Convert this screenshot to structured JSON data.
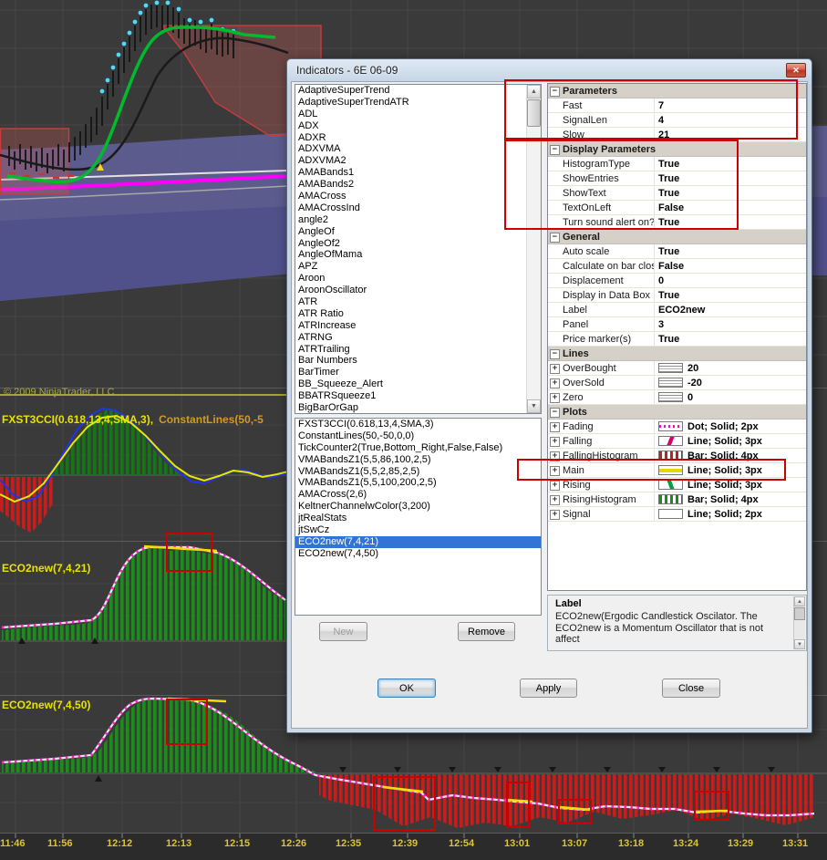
{
  "window": {
    "title": "Indicators - 6E 06-09"
  },
  "icons": {
    "close": "✕",
    "scroll_up": "▲",
    "scroll_down": "▼"
  },
  "available_indicators": [
    "AdaptiveSuperTrend",
    "AdaptiveSuperTrendATR",
    "ADL",
    "ADX",
    "ADXR",
    "ADXVMA",
    "ADXVMA2",
    "AMABands1",
    "AMABands2",
    "AMACross",
    "AMACrossInd",
    "angle2",
    "AngleOf",
    "AngleOf2",
    "AngleOfMama",
    "APZ",
    "Aroon",
    "AroonOscillator",
    "ATR",
    "ATR Ratio",
    "ATRIncrease",
    "ATRNG",
    "ATRTrailing",
    "Bar Numbers",
    "BarTimer",
    "BB_Squeeze_Alert",
    "BBATRSqueeze1",
    "BigBarOrGap"
  ],
  "configured_indicators": [
    {
      "label": "FXST3CCI(0.618,13,4,SMA,3)",
      "selected": false
    },
    {
      "label": "ConstantLines(50,-50,0,0)",
      "selected": false
    },
    {
      "label": "TickCounter2(True,Bottom_Right,False,False)",
      "selected": false
    },
    {
      "label": "VMABandsZ1(5,5,86,100,2,5)",
      "selected": false
    },
    {
      "label": "VMABandsZ1(5,5,2,85,2,5)",
      "selected": false
    },
    {
      "label": "VMABandsZ1(5,5,100,200,2,5)",
      "selected": false
    },
    {
      "label": "AMACross(2,6)",
      "selected": false
    },
    {
      "label": "KeltnerChannelwColor(3,200)",
      "selected": false
    },
    {
      "label": "jtRealStats",
      "selected": false
    },
    {
      "label": "jtSwCz",
      "selected": false
    },
    {
      "label": "ECO2new(7,4,21)",
      "selected": true
    },
    {
      "label": "ECO2new(7,4,50)",
      "selected": false
    }
  ],
  "actions": {
    "new": "New",
    "remove": "Remove",
    "ok": "OK",
    "apply": "Apply",
    "close": "Close"
  },
  "property_grid": {
    "rows": [
      {
        "type": "section",
        "name": "Parameters"
      },
      {
        "type": "prop",
        "name": "Fast",
        "value": "7"
      },
      {
        "type": "prop",
        "name": "SignalLen",
        "value": "4"
      },
      {
        "type": "prop",
        "name": "Slow",
        "value": "21"
      },
      {
        "type": "section",
        "name": "Display Parameters"
      },
      {
        "type": "prop",
        "name": "HistogramType",
        "value": "True"
      },
      {
        "type": "prop",
        "name": "ShowEntries",
        "value": "True"
      },
      {
        "type": "prop",
        "name": "ShowText",
        "value": "True"
      },
      {
        "type": "prop",
        "name": "TextOnLeft",
        "value": "False"
      },
      {
        "type": "prop",
        "name": "Turn sound alert on?",
        "value": "True"
      },
      {
        "type": "section",
        "name": "General"
      },
      {
        "type": "prop",
        "name": "Auto scale",
        "value": "True"
      },
      {
        "type": "prop",
        "name": "Calculate on bar close",
        "value": "False"
      },
      {
        "type": "prop",
        "name": "Displacement",
        "value": "0"
      },
      {
        "type": "prop",
        "name": "Display in Data Box",
        "value": "True"
      },
      {
        "type": "prop",
        "name": "Label",
        "value": "ECO2new"
      },
      {
        "type": "prop",
        "name": "Panel",
        "value": "3"
      },
      {
        "type": "prop",
        "name": "Price marker(s)",
        "value": "True"
      },
      {
        "type": "section",
        "name": "Lines"
      },
      {
        "type": "prop",
        "name": "OverBought",
        "value": "20",
        "expand": true,
        "swatch": "lines"
      },
      {
        "type": "prop",
        "name": "OverSold",
        "value": "-20",
        "expand": true,
        "swatch": "lines"
      },
      {
        "type": "prop",
        "name": "Zero",
        "value": "0",
        "expand": true,
        "swatch": "lines"
      },
      {
        "type": "section",
        "name": "Plots"
      },
      {
        "type": "prop",
        "name": "Fading",
        "value": "Dot; Solid; 2px",
        "expand": true,
        "swatch": "fading"
      },
      {
        "type": "prop",
        "name": "Falling",
        "value": "Line; Solid; 3px",
        "expand": true,
        "swatch": "falling"
      },
      {
        "type": "prop",
        "name": "FallingHistogram",
        "value": "Bar; Solid; 4px",
        "expand": true,
        "swatch": "falling-histogram"
      },
      {
        "type": "prop",
        "name": "Main",
        "value": "Line; Solid; 3px",
        "expand": true,
        "swatch": "main"
      },
      {
        "type": "prop",
        "name": "Rising",
        "value": "Line; Solid; 3px",
        "expand": true,
        "swatch": "rising"
      },
      {
        "type": "prop",
        "name": "RisingHistogram",
        "value": "Bar; Solid; 4px",
        "expand": true,
        "swatch": "rising-histogram"
      },
      {
        "type": "prop",
        "name": "Signal",
        "value": "Line; Solid; 2px",
        "expand": true,
        "swatch": "signal"
      }
    ]
  },
  "help_panel": {
    "title": "Label",
    "text": "ECO2new(Ergodic Candlestick Oscilator.  The ECO2new is a Momentum Oscillator that is not affect"
  },
  "chart": {
    "copyright": "© 2009 NinjaTrader, LLC",
    "labels": {
      "panel2_a": "FXST3CCI(0.618,13,4,SMA,3),",
      "panel2_b": "ConstantLines(50,-5",
      "panel3": "ECO2new(7,4,21)",
      "panel4": "ECO2new(7,4,50)"
    },
    "time_axis": [
      "11:46",
      "11:56",
      "12:12",
      "12:13",
      "12:15",
      "12:26",
      "12:35",
      "12:39",
      "12:54",
      "13:01",
      "13:07",
      "13:18",
      "13:24",
      "13:29",
      "13:31"
    ]
  },
  "colors": {
    "selection": "#3273d8",
    "annotation": "#cc0000",
    "plot_main": "#e3d800",
    "plot_rising": "#1f8b1f",
    "plot_falling": "#c22020",
    "axis_text": "#ddc531"
  }
}
